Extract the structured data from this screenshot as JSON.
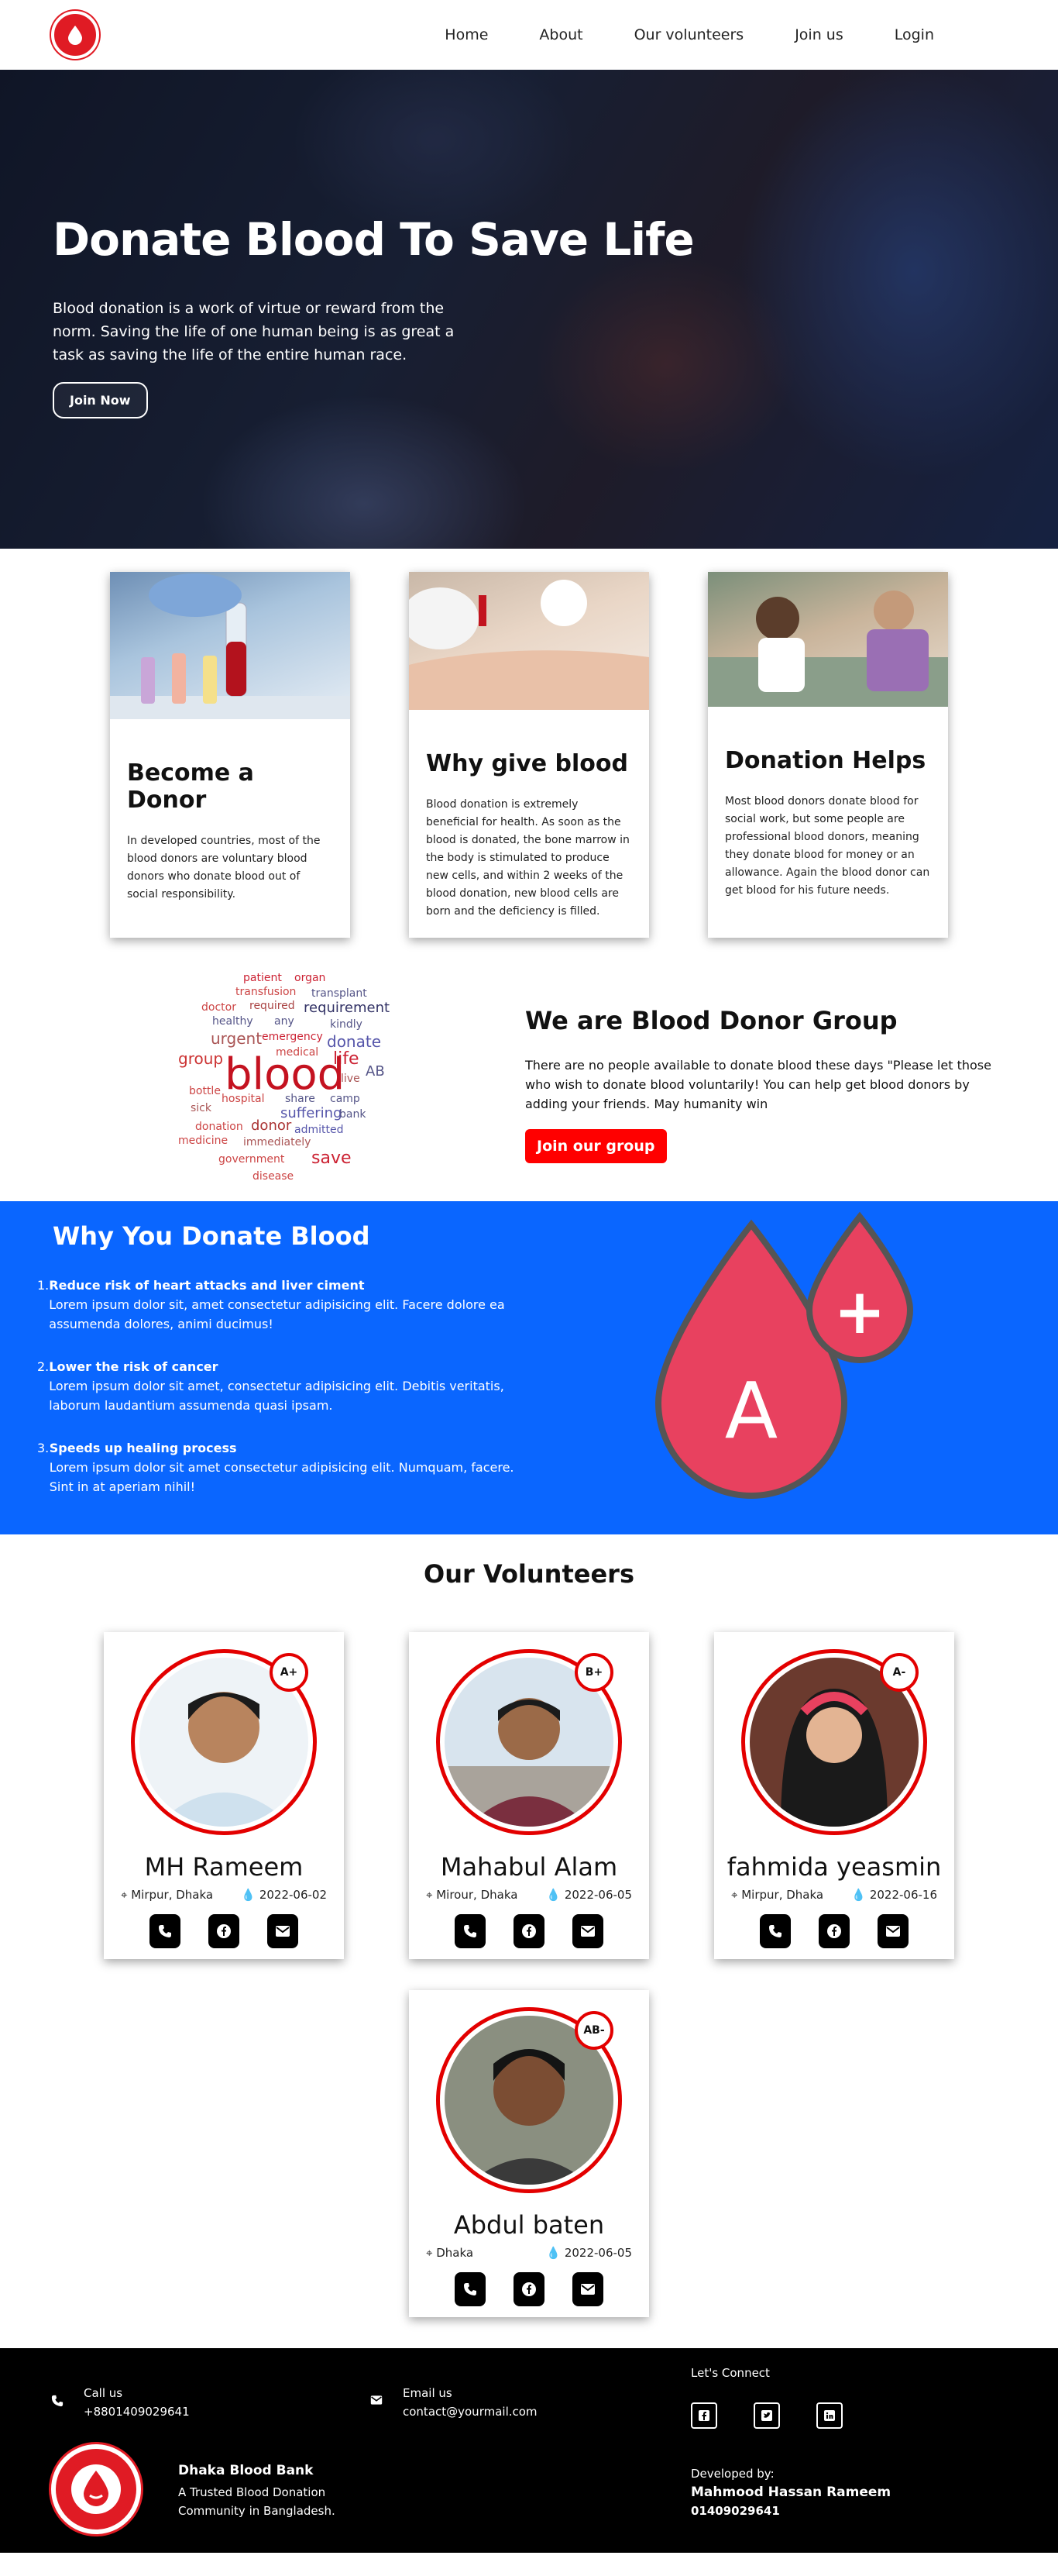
{
  "nav": {
    "links": [
      "Home",
      "About",
      "Our volunteers",
      "Join us",
      "Login"
    ]
  },
  "hero": {
    "title": "Donate Blood To Save Life",
    "text": "Blood donation is a work of virtue or reward from the norm. Saving the life of one human being is as great a task as saving the life of the entire human race.",
    "button": "Join Now"
  },
  "cards": [
    {
      "title": "Become a Donor",
      "text": "In developed countries, most of the blood donors are voluntary blood donors who donate blood out of social responsibility."
    },
    {
      "title": "Why give blood",
      "text": "Blood donation is extremely beneficial for health. As soon as the blood is donated, the bone marrow in the body is stimulated to produce new cells, and within 2 weeks of the blood donation, new blood cells are born and the deficiency is filled."
    },
    {
      "title": "Donation Helps",
      "text": "Most blood donors donate blood for social work, but some people are professional blood donors, meaning they donate blood for money or an allowance. Again the blood donor can get blood for his future needs."
    }
  ],
  "wordcloud": [
    "patient",
    "organ",
    "transfusion",
    "transplant",
    "doctor",
    "required",
    "requirement",
    "healthy",
    "any",
    "kindly",
    "urgent",
    "emergency",
    "donate",
    "group",
    "medical",
    "life",
    "blood",
    "AB",
    "bottle",
    "live",
    "hospital",
    "share",
    "camp",
    "sick",
    "suffering",
    "bank",
    "donation",
    "donor",
    "admitted",
    "medicine",
    "immediately",
    "government",
    "save",
    "disease"
  ],
  "group": {
    "title": "We are Blood Donor Group",
    "text": "There are no people available to donate blood these days \"Please let those who wish to donate blood voluntarily! You can help get blood donors by adding your friends. May humanity win",
    "button": "Join our group"
  },
  "why": {
    "title": "Why You Donate Blood",
    "items": [
      {
        "num": "1.",
        "head": "Reduce risk of heart attacks and liver ciment",
        "text": "Lorem ipsum dolor sit, amet consectetur adipisicing elit. Facere dolore ea assumenda dolores, animi ducimus!"
      },
      {
        "num": "2.",
        "head": "Lower the risk of cancer",
        "text": "Lorem ipsum dolor sit amet, consectetur adipisicing elit. Debitis veritatis, laborum laudantium assumenda quasi ipsam."
      },
      {
        "num": "3.",
        "head": "Speeds up healing process",
        "text": "Lorem ipsum dolor sit amet consectetur adipisicing elit. Numquam, facere. Sint in at aperiam nihil!"
      }
    ],
    "drop_letter": "A",
    "drop_sign": "+",
    "drop_color": "#e8415f"
  },
  "volunteers": {
    "title": "Our Volunteers",
    "people": [
      {
        "name": "MH Rameem",
        "group": "A+",
        "location": "Mirpur, Dhaka",
        "date": "2022-06-02"
      },
      {
        "name": "Mahabul Alam",
        "group": "B+",
        "location": "Mirour, Dhaka",
        "date": "2022-06-05"
      },
      {
        "name": "fahmida yeasmin",
        "group": "A-",
        "location": "Mirpur, Dhaka",
        "date": "2022-06-16"
      },
      {
        "name": "Abdul baten",
        "group": "AB-",
        "location": "Dhaka",
        "date": "2022-06-05"
      }
    ]
  },
  "footer": {
    "call_label": "Call us",
    "call_value": "+8801409029641",
    "email_label": "Email us",
    "email_value": "contact@yourmail.com",
    "connect": "Let's Connect",
    "brand": "Dhaka Blood Bank",
    "tagline": "A Trusted Blood Donation Community in Bangladesh.",
    "dev_label": "Developed by:",
    "dev_name": "Mahmood Hassan Rameem",
    "dev_phone": "01409029641"
  },
  "colors": {
    "brand_red": "#e01b24",
    "blue_section": "#0a66ff",
    "button_red": "#ff0000"
  }
}
